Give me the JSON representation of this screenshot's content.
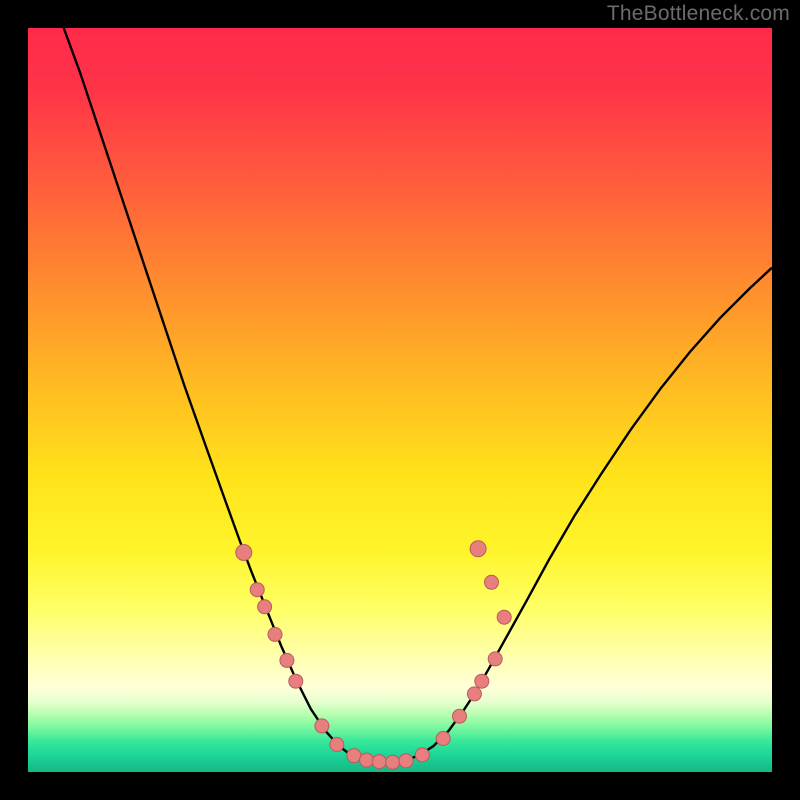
{
  "watermark": "TheBottleneck.com",
  "colors": {
    "frame": "#000000",
    "curve": "#000000",
    "dot_fill": "#e87e7e",
    "dot_stroke": "#b85c5c",
    "gradient_stops": [
      {
        "offset": 0.0,
        "color": "#ff2a4b"
      },
      {
        "offset": 0.08,
        "color": "#ff3348"
      },
      {
        "offset": 0.2,
        "color": "#ff5a3d"
      },
      {
        "offset": 0.34,
        "color": "#ff8a2f"
      },
      {
        "offset": 0.48,
        "color": "#ffbb22"
      },
      {
        "offset": 0.6,
        "color": "#ffe21a"
      },
      {
        "offset": 0.7,
        "color": "#fff42a"
      },
      {
        "offset": 0.78,
        "color": "#ffff66"
      },
      {
        "offset": 0.84,
        "color": "#ffffa8"
      },
      {
        "offset": 0.885,
        "color": "#ffffd8"
      },
      {
        "offset": 0.905,
        "color": "#e8ffcf"
      },
      {
        "offset": 0.922,
        "color": "#b8ffb0"
      },
      {
        "offset": 0.94,
        "color": "#7cf79e"
      },
      {
        "offset": 0.958,
        "color": "#3ae89a"
      },
      {
        "offset": 0.975,
        "color": "#1fd898"
      },
      {
        "offset": 0.99,
        "color": "#18c48e"
      },
      {
        "offset": 1.0,
        "color": "#17b884"
      }
    ]
  },
  "chart_data": {
    "type": "line",
    "title": "",
    "xlabel": "",
    "ylabel": "",
    "ylim": [
      0,
      1
    ],
    "xlim": [
      0,
      1
    ],
    "note": "Curve y values are vertical position (0=top, 1=bottom). Dots share the same coordinate system.",
    "curve": [
      {
        "x": 0.048,
        "y": 0.0
      },
      {
        "x": 0.07,
        "y": 0.06
      },
      {
        "x": 0.095,
        "y": 0.135
      },
      {
        "x": 0.12,
        "y": 0.21
      },
      {
        "x": 0.15,
        "y": 0.3
      },
      {
        "x": 0.18,
        "y": 0.39
      },
      {
        "x": 0.21,
        "y": 0.48
      },
      {
        "x": 0.24,
        "y": 0.565
      },
      {
        "x": 0.265,
        "y": 0.635
      },
      {
        "x": 0.285,
        "y": 0.69
      },
      {
        "x": 0.3,
        "y": 0.73
      },
      {
        "x": 0.32,
        "y": 0.78
      },
      {
        "x": 0.34,
        "y": 0.83
      },
      {
        "x": 0.36,
        "y": 0.875
      },
      {
        "x": 0.38,
        "y": 0.915
      },
      {
        "x": 0.4,
        "y": 0.945
      },
      {
        "x": 0.418,
        "y": 0.965
      },
      {
        "x": 0.435,
        "y": 0.978
      },
      {
        "x": 0.455,
        "y": 0.985
      },
      {
        "x": 0.48,
        "y": 0.987
      },
      {
        "x": 0.505,
        "y": 0.985
      },
      {
        "x": 0.525,
        "y": 0.978
      },
      {
        "x": 0.545,
        "y": 0.965
      },
      {
        "x": 0.565,
        "y": 0.945
      },
      {
        "x": 0.585,
        "y": 0.918
      },
      {
        "x": 0.6,
        "y": 0.895
      },
      {
        "x": 0.62,
        "y": 0.86
      },
      {
        "x": 0.645,
        "y": 0.815
      },
      {
        "x": 0.67,
        "y": 0.77
      },
      {
        "x": 0.7,
        "y": 0.715
      },
      {
        "x": 0.735,
        "y": 0.655
      },
      {
        "x": 0.77,
        "y": 0.6
      },
      {
        "x": 0.81,
        "y": 0.54
      },
      {
        "x": 0.85,
        "y": 0.485
      },
      {
        "x": 0.89,
        "y": 0.435
      },
      {
        "x": 0.93,
        "y": 0.39
      },
      {
        "x": 0.97,
        "y": 0.35
      },
      {
        "x": 1.0,
        "y": 0.322
      }
    ],
    "dots": [
      {
        "x": 0.29,
        "y": 0.705,
        "r": 8
      },
      {
        "x": 0.308,
        "y": 0.755,
        "r": 7
      },
      {
        "x": 0.318,
        "y": 0.778,
        "r": 7
      },
      {
        "x": 0.332,
        "y": 0.815,
        "r": 7
      },
      {
        "x": 0.348,
        "y": 0.85,
        "r": 7
      },
      {
        "x": 0.36,
        "y": 0.878,
        "r": 7
      },
      {
        "x": 0.395,
        "y": 0.938,
        "r": 7
      },
      {
        "x": 0.415,
        "y": 0.963,
        "r": 7
      },
      {
        "x": 0.438,
        "y": 0.978,
        "r": 7
      },
      {
        "x": 0.455,
        "y": 0.984,
        "r": 7
      },
      {
        "x": 0.472,
        "y": 0.986,
        "r": 7
      },
      {
        "x": 0.49,
        "y": 0.987,
        "r": 7
      },
      {
        "x": 0.508,
        "y": 0.985,
        "r": 7
      },
      {
        "x": 0.53,
        "y": 0.977,
        "r": 7
      },
      {
        "x": 0.558,
        "y": 0.955,
        "r": 7
      },
      {
        "x": 0.58,
        "y": 0.925,
        "r": 7
      },
      {
        "x": 0.6,
        "y": 0.895,
        "r": 7
      },
      {
        "x": 0.61,
        "y": 0.878,
        "r": 7
      },
      {
        "x": 0.628,
        "y": 0.848,
        "r": 7
      },
      {
        "x": 0.605,
        "y": 0.7,
        "r": 8
      },
      {
        "x": 0.623,
        "y": 0.745,
        "r": 7
      },
      {
        "x": 0.64,
        "y": 0.792,
        "r": 7
      }
    ]
  }
}
